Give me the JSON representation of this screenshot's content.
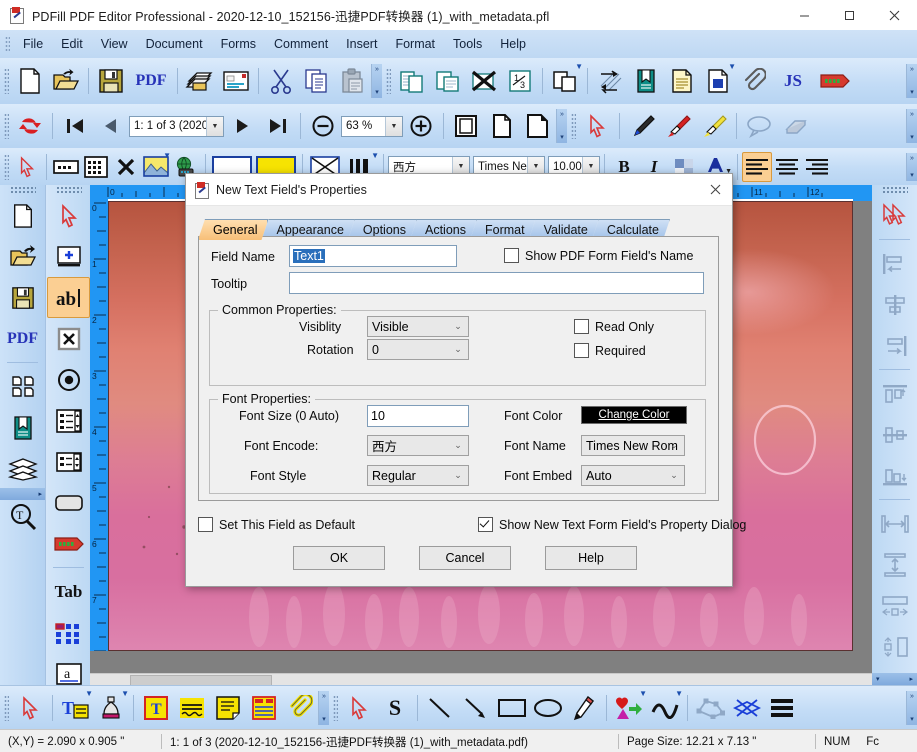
{
  "window": {
    "title": "PDFill PDF Editor Professional - 2020-12-10_152156-迅捷PDF转换器 (1)_with_metadata.pfl",
    "app_icon": "pdf-editor-icon",
    "minimize": "–",
    "maximize": "☐",
    "close": "✕"
  },
  "menubar": {
    "items": [
      "File",
      "Edit",
      "View",
      "Document",
      "Forms",
      "Comment",
      "Insert",
      "Format",
      "Tools",
      "Help"
    ]
  },
  "toolbar_main": {
    "buttons": [
      "new-document-icon",
      "open-folder-icon",
      "save-icon",
      "pdf-text-icon",
      "print-icon",
      "email-icon",
      "cut-scissors-icon",
      "copy-icon",
      "paste-icon"
    ],
    "pdf_label": "PDF",
    "buttons2": [
      "insert-pages-icon",
      "extract-pages-icon",
      "delete-pages-icon",
      "number-pages-icon",
      "duplicate-pages-icon",
      "reorder-pages-icon",
      "bookmark-icon",
      "document-info-icon",
      "watermark-icon",
      "attachment-icon",
      "javascript-icon",
      "barcode-icon"
    ],
    "js_label": "JS"
  },
  "toolbar_nav": {
    "refresh_icon": "refresh-icon",
    "first_page_icon": "first-page-icon",
    "prev_page_icon": "previous-page-icon",
    "page_selector_value": "1: 1 of 3 (2020",
    "next_page_icon": "next-page-icon",
    "last_page_icon": "last-page-icon",
    "zoom_out_icon": "zoom-out-icon",
    "zoom_value": "63 %",
    "zoom_in_icon": "zoom-in-icon",
    "fit_page_icon": "fit-page-icon",
    "fit_width_icon": "fit-width-icon",
    "actual_size_icon": "actual-size-icon",
    "select_icon": "select-arrow-icon",
    "pencil_icon": "pencil-icon",
    "red-pen_icon": "red-marker-icon",
    "highlighter_icon": "highlighter-icon",
    "callout_icon": "speech-bubble-icon",
    "eraser_icon": "eraser-icon"
  },
  "toolbar_form": {
    "select_icon": "select-arrow-icon",
    "text_field_icon": "text-field-icon",
    "grid_icon": "grid-icon",
    "delete_icon": "delete-x-icon",
    "image_icon": "image-icon",
    "web_icon": "web-link-icon",
    "white_box_icon": "white-fill-icon",
    "yellow_box_icon": "yellow-fill-icon",
    "no_border_icon": "no-border-icon",
    "border_width_icon": "border-width-icon",
    "encode_value": "西方",
    "font_value": "Times Ne",
    "size_value": "10.00",
    "bold_label": "B",
    "italic_label": "I",
    "fill_color_icon": "fill-color-icon",
    "font_color_icon": "font-color-icon",
    "align_left_icon": "align-left-icon",
    "align_center_icon": "align-center-icon",
    "align_right_icon": "align-right-icon"
  },
  "left_toolbar_1": {
    "items": [
      "new-document-icon",
      "open-folder-icon",
      "save-icon",
      "pdf-text-icon",
      "thumbnails-icon",
      "bookmark-icon",
      "layers-icon",
      "search-text-icon"
    ],
    "pdf_label": "PDF"
  },
  "left_toolbar_2": {
    "items": [
      "select-arrow-icon",
      "add-field-icon",
      "text-field-icon",
      "checkbox-field-icon",
      "radio-button-field-icon",
      "list-box-field-icon",
      "combo-box-field-icon",
      "push-button-field-icon",
      "barcode-field-icon",
      "tab-order-icon",
      "grid-fields-icon",
      "signature-field-icon"
    ],
    "tab_label": "Tab",
    "active": "text-field-icon"
  },
  "right_toolbar": {
    "items": [
      "select-arrow-icon",
      "align-left-icon",
      "align-center-horizontal-icon",
      "align-right-icon",
      "align-top-icon",
      "align-middle-icon",
      "align-bottom-icon",
      "distribute-horizontal-icon",
      "distribute-vertical-icon",
      "same-width-icon",
      "same-height-icon",
      "same-size-icon"
    ]
  },
  "bottom_toolbar": {
    "group1": [
      "select-arrow-icon",
      "text-tool-icon",
      "ink-bottle-icon",
      "text-box-icon",
      "highlight-icon",
      "sticky-note-icon",
      "file-attachment-icon",
      "paperclip-icon"
    ],
    "group2": [
      "select-arrow-icon",
      "stamp-s-icon",
      "line-icon",
      "arrow-icon",
      "rectangle-icon",
      "ellipse-icon",
      "pencil-draw-icon",
      "shapes-icon",
      "curve-icon",
      "polygon-icon",
      "cut-shape-icon",
      "lines-icon"
    ]
  },
  "document": {
    "h_ruler_labels": [
      "0",
      "1",
      "11",
      "12"
    ],
    "v_ruler_labels": [
      "0",
      "1",
      "2",
      "3",
      "4",
      "5",
      "6",
      "7"
    ]
  },
  "dialog": {
    "title": "New Text Field's Properties",
    "icon": "pdf-field-icon",
    "close": "✕",
    "tabs": [
      {
        "label": "General",
        "selected": true
      },
      {
        "label": "Appearance",
        "selected": false
      },
      {
        "label": "Options",
        "selected": false
      },
      {
        "label": "Actions",
        "selected": false
      },
      {
        "label": "Format",
        "selected": false
      },
      {
        "label": "Validate",
        "selected": false
      },
      {
        "label": "Calculate",
        "selected": false
      }
    ],
    "field_name_label": "Field Name",
    "field_name_value": "Text1",
    "show_form_field_name_label": "Show PDF Form Field's Name",
    "show_form_field_name_checked": false,
    "tooltip_label": "Tooltip",
    "tooltip_value": "",
    "common_properties_caption": "Common Properties:",
    "visibility_label": "Visiblity",
    "visibility_value": "Visible",
    "rotation_label": "Rotation",
    "rotation_value": "0",
    "read_only_label": "Read Only",
    "read_only_checked": false,
    "required_label": "Required",
    "required_checked": false,
    "font_properties_caption": "Font Properties:",
    "font_size_label": "Font Size (0 Auto)",
    "font_size_value": "10",
    "font_encode_label": "Font Encode:",
    "font_encode_value": "西方",
    "font_style_label": "Font Style",
    "font_style_value": "Regular",
    "font_color_label": "Font Color",
    "change_color_button": "Change Color",
    "font_name_label": "Font Name",
    "font_name_value": "Times New Rom",
    "font_embed_label": "Font Embed",
    "font_embed_value": "Auto",
    "set_default_label": "Set This Field as Default",
    "set_default_checked": false,
    "show_dialog_label": "Show New Text Form Field's Property Dialog",
    "show_dialog_checked": true,
    "ok_button": "OK",
    "cancel_button": "Cancel",
    "help_button": "Help"
  },
  "statusbar": {
    "coords": "(X,Y) = 2.090 x 0.905 \"",
    "page_info": "1: 1 of 3 (2020-12-10_152156-迅捷PDF转换器 (1)_with_metadata.pdf)",
    "page_size": "Page Size: 12.21 x 7.13 \"",
    "num": "NUM",
    "extra": "Fc"
  },
  "colors": {
    "accent_blue": "#2a6fbb",
    "tab_selected": "#f7bf78",
    "ruler_blue": "#2196f3",
    "toolbar_blue": "#c3dcf6"
  }
}
